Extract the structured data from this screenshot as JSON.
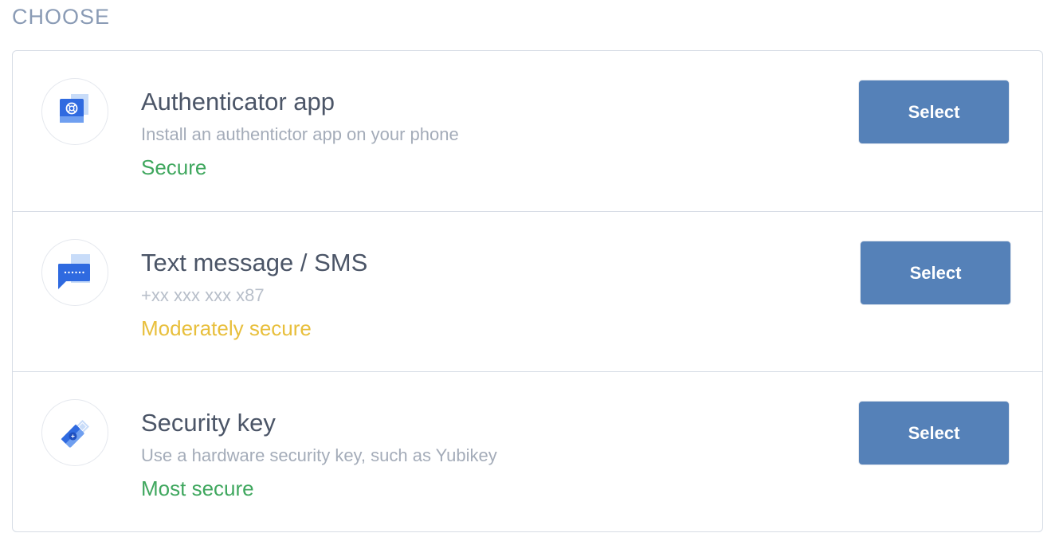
{
  "heading": "CHOOSE",
  "options": [
    {
      "title": "Authenticator app",
      "description": "Install an authentictor app on your phone",
      "security_level": "Secure",
      "level_color": "#3fa75e",
      "icon": "authenticator-app-icon",
      "button_label": "Select"
    },
    {
      "title": "Text message / SMS",
      "description": "+xx xxx xxx x87",
      "security_level": "Moderately secure",
      "level_color": "#e8bf3c",
      "icon": "sms-message-icon",
      "button_label": "Select"
    },
    {
      "title": "Security key",
      "description": "Use a hardware security key, such as Yubikey",
      "security_level": "Most secure",
      "level_color": "#3fa75e",
      "icon": "security-key-icon",
      "button_label": "Select"
    }
  ],
  "colors": {
    "button": "#5581b8",
    "title": "#4b5567",
    "description": "#a4acb9",
    "heading": "#8a9bb5",
    "icon_primary": "#2f6ae0",
    "icon_secondary": "#b9d2f7"
  }
}
